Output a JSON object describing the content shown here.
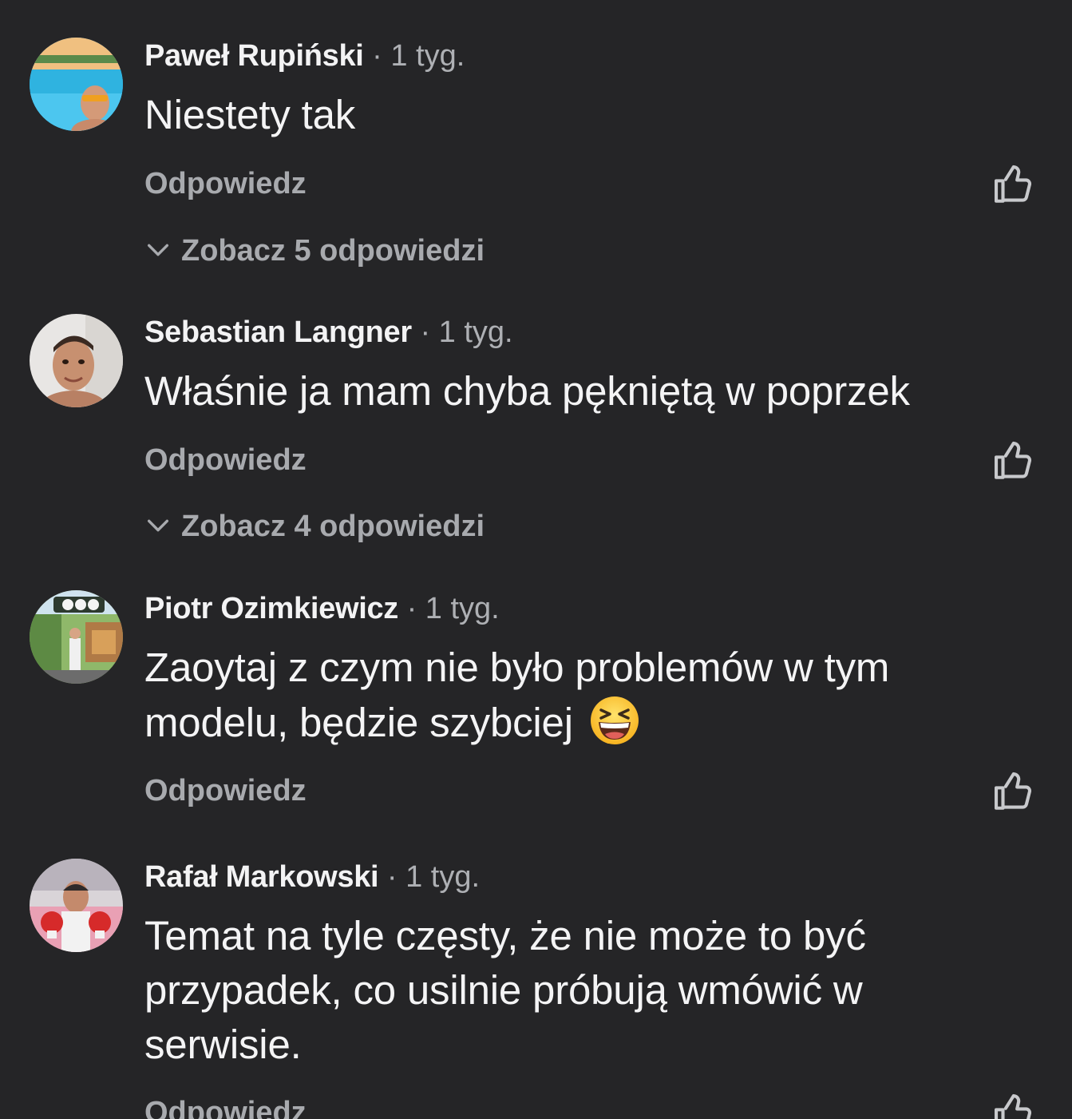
{
  "comments": [
    {
      "author": "Paweł Rupiński",
      "meta": "· 1 tyg.",
      "text": "Niestety tak",
      "reply_label": "Odpowiedz",
      "replies_label": "Zobacz 5 odpowiedzi",
      "avatar_icon": "avatar-pool-sunglasses"
    },
    {
      "author": "Sebastian Langner",
      "meta": "· 1 tyg.",
      "text": "Właśnie ja mam chyba pękniętą w poprzek",
      "reply_label": "Odpowiedz",
      "replies_label": "Zobacz 4 odpowiedzi",
      "avatar_icon": "avatar-selfie"
    },
    {
      "author": "Piotr Ozimkiewicz",
      "meta": "· 1 tyg.",
      "text_line1": "Zaoytaj z czym nie było problemów w tym",
      "text_line2": "modelu, będzie szybciej",
      "emoji": "grinning-squinting-face-emoji",
      "reply_label": "Odpowiedz",
      "avatar_icon": "avatar-garden"
    },
    {
      "author": "Rafał Markowski",
      "meta": "· 1 tyg.",
      "text_line1": "Temat na tyle częsty, że nie może to być",
      "text_line2": "przypadek, co usilnie próbują wmówić w",
      "text_line3": "serwisie.",
      "reply_label": "Odpowiedz",
      "avatar_icon": "avatar-boxing"
    }
  ],
  "colors": {
    "background": "#252527",
    "author": "#f3f3f4",
    "text": "#f4f4f5",
    "secondary": "#a8aaae"
  },
  "icons": {
    "like": "thumbs-up-outline-icon",
    "expand": "chevron-down-icon"
  }
}
